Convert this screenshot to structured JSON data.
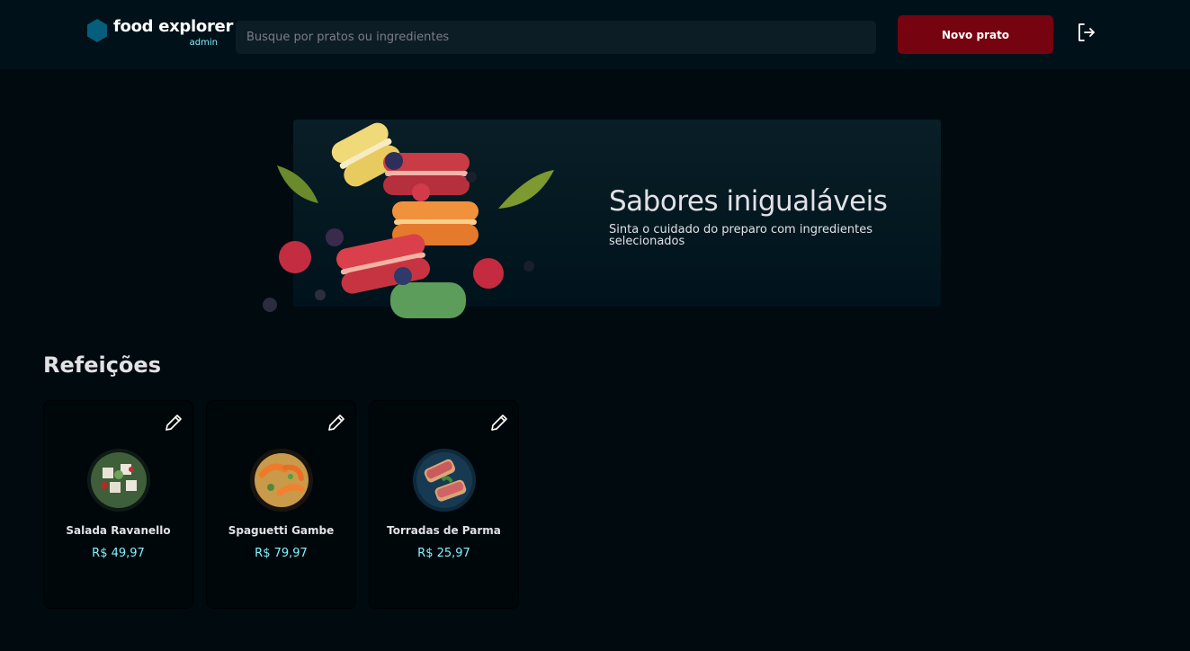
{
  "header": {
    "brand_name": "food explorer",
    "brand_role": "admin",
    "search_placeholder": "Busque por pratos ou ingredientes",
    "new_dish_label": "Novo prato",
    "logout_icon": "logout-icon"
  },
  "banner": {
    "title": "Sabores inigualáveis",
    "subtitle": "Sinta o cuidado do preparo com ingredientes selecionados"
  },
  "section": {
    "title": "Refeições",
    "dishes": [
      {
        "name": "Salada Ravanello",
        "price": "R$ 49,97",
        "image": "salad-image"
      },
      {
        "name": "Spaguetti Gambe",
        "price": "R$ 79,97",
        "image": "shrimp-pasta-image"
      },
      {
        "name": "Torradas de Parma",
        "price": "R$ 25,97",
        "image": "parma-toast-image"
      }
    ]
  },
  "colors": {
    "background": "#000a0f",
    "header": "#00111a",
    "accent": "#82f3ff",
    "button": "#750310"
  }
}
